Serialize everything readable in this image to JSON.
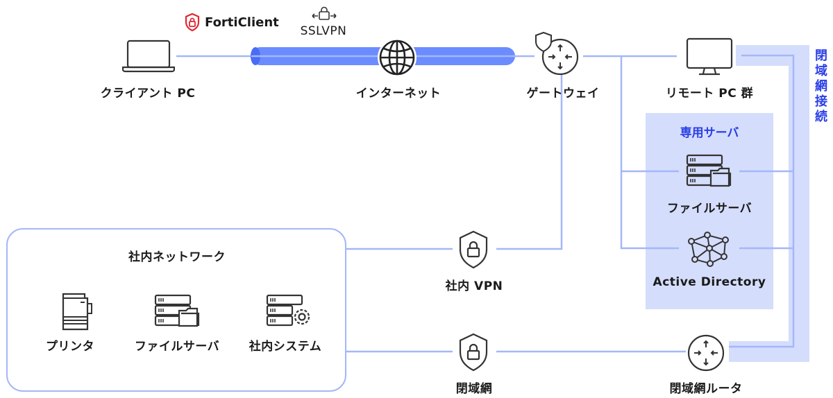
{
  "colors": {
    "line": "#a4b7f8",
    "tube": "#6b8cff",
    "tube_end": "#4a6cf5",
    "band": "#d5ddfc",
    "accent_text": "#2a3fe6",
    "forti_red": "#e0282e",
    "icon_stroke": "#333333"
  },
  "top_row": {
    "client_pc": {
      "label": "クライアント PC",
      "icon": "laptop-icon"
    },
    "forticlient": {
      "label": "FortiClient",
      "icon": "shield-lock-icon"
    },
    "sslvpn": {
      "label": "SSLVPN",
      "icon": "lock-arrows-icon"
    },
    "internet": {
      "label": "インターネット",
      "icon": "globe-icon"
    },
    "gateway": {
      "label": "ゲートウェイ",
      "icon": "router-shield-icon"
    },
    "remote_pc": {
      "label": "リモート PC 群",
      "icon": "monitor-icon"
    }
  },
  "dedicated_servers": {
    "title": "専用サーバ",
    "items": [
      {
        "label": "ファイルサーバ",
        "icon": "file-server-icon"
      },
      {
        "label": "Active Directory",
        "icon": "network-mesh-icon"
      }
    ]
  },
  "closed_network_connection": {
    "label": "閉域網接続"
  },
  "intranet": {
    "title": "社内ネットワーク",
    "items": [
      {
        "label": "プリンタ",
        "icon": "printer-icon"
      },
      {
        "label": "ファイルサーバ",
        "icon": "file-server-icon"
      },
      {
        "label": "社内システム",
        "icon": "system-server-icon"
      }
    ]
  },
  "intranet_vpn": {
    "label": "社内 VPN",
    "icon": "shield-lock-icon"
  },
  "closed_network": {
    "label": "閉域網",
    "icon": "shield-lock-icon"
  },
  "closed_network_router": {
    "label": "閉域網ルータ",
    "icon": "router-icon"
  }
}
